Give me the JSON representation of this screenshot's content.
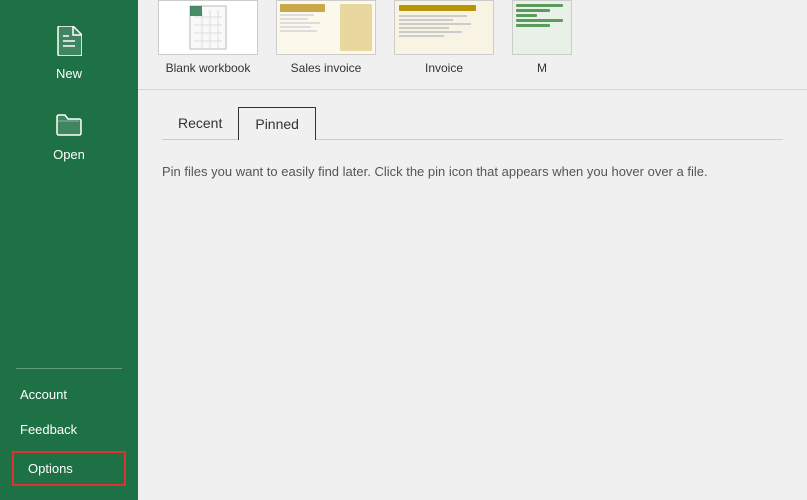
{
  "sidebar": {
    "accent_color": "#1e7145",
    "nav_items": [
      {
        "id": "new",
        "label": "New",
        "icon": "new-file-icon"
      },
      {
        "id": "open",
        "label": "Open",
        "icon": "open-folder-icon"
      }
    ],
    "bottom_items": [
      {
        "id": "account",
        "label": "Account"
      },
      {
        "id": "feedback",
        "label": "Feedback"
      }
    ],
    "options_label": "Options"
  },
  "templates": {
    "items": [
      {
        "id": "blank",
        "label": "Blank workbook",
        "type": "blank"
      },
      {
        "id": "sales-invoice",
        "label": "Sales invoice",
        "type": "sales"
      },
      {
        "id": "invoice",
        "label": "Invoice",
        "type": "invoice"
      },
      {
        "id": "m-template",
        "label": "M",
        "type": "m"
      }
    ]
  },
  "tabs": {
    "items": [
      {
        "id": "recent",
        "label": "Recent",
        "active": false
      },
      {
        "id": "pinned",
        "label": "Pinned",
        "active": true
      }
    ]
  },
  "pinned": {
    "message": "Pin files you want to easily find later. Click the pin icon that appears when you hover over a file."
  }
}
